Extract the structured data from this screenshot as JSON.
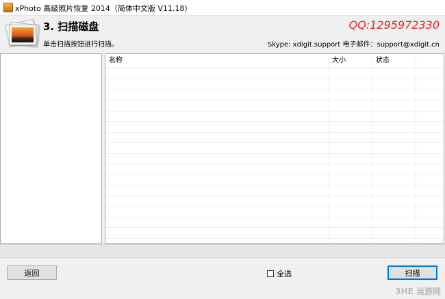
{
  "window": {
    "title": "xPhoto 高级照片恢复 2014（简体中文版 V11.18）"
  },
  "header": {
    "step_title": "3. 扫描磁盘",
    "instruction": "单击扫描按钮进行扫描。",
    "qq": "QQ:1295972330",
    "contact": "Skype: xdigit.support   电子邮件：support@xdigit.cn"
  },
  "file_list": {
    "columns": [
      {
        "label": "名称"
      },
      {
        "label": "大小"
      },
      {
        "label": "状态"
      }
    ],
    "rows": []
  },
  "footer": {
    "back_label": "返回",
    "select_all_label": "全选",
    "select_all_checked": false,
    "scan_label": "扫描"
  },
  "watermark": "3HE 当游网",
  "colors": {
    "qq": "#e8201e",
    "accent": "#0078d7"
  }
}
